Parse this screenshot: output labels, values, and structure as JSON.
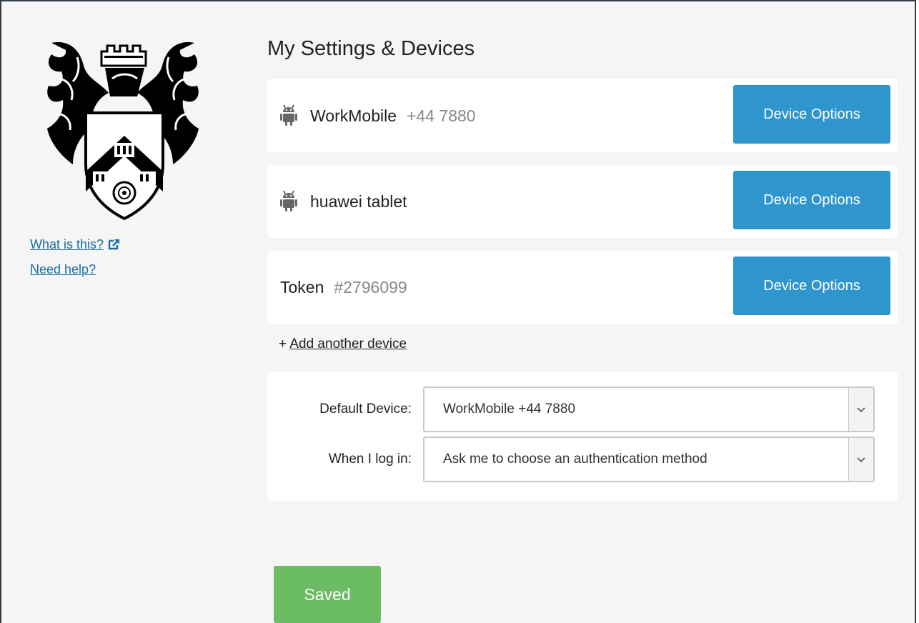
{
  "sidebar": {
    "logo_icon": "university-crest-icon",
    "links": [
      {
        "label": "What is this?",
        "icon": "external-link-icon"
      },
      {
        "label": "Need help?"
      }
    ]
  },
  "main": {
    "title": "My Settings & Devices",
    "devices": [
      {
        "name": "WorkMobile",
        "number": "+44 7880",
        "icon": "android-icon",
        "button_label": "Device Options"
      },
      {
        "name": "huawei tablet",
        "number": "",
        "icon": "android-icon",
        "button_label": "Device Options"
      },
      {
        "name": "Token",
        "number": "#2796099",
        "icon": "",
        "button_label": "Device Options"
      }
    ],
    "add_device": {
      "prefix": "+",
      "label": "Add another device"
    },
    "settings": {
      "default_device_label": "Default Device:",
      "default_device_value": "WorkMobile +44 7880",
      "login_label": "When I log in:",
      "login_value": "Ask me to choose an authentication method"
    },
    "saved_button_label": "Saved"
  },
  "colors": {
    "primary_button": "#2e96cd",
    "success_button": "#6cbc63",
    "link": "#1a6ea0",
    "page_background": "#f5f5f5"
  }
}
